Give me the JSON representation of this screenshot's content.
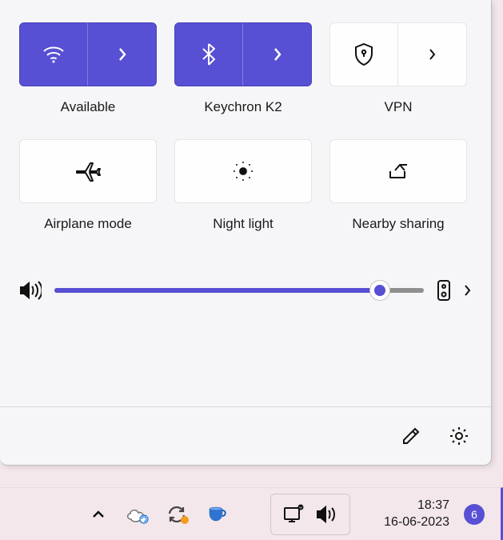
{
  "colors": {
    "accent": "#5750d4",
    "panel_bg": "#f6f6f8",
    "taskbar_bg": "#f4e7eb"
  },
  "quick_settings": {
    "tiles": [
      {
        "id": "wifi",
        "label": "Available",
        "active": true,
        "split": true,
        "icon": "wifi-icon"
      },
      {
        "id": "bluetooth",
        "label": "Keychron K2",
        "active": true,
        "split": true,
        "icon": "bluetooth-icon"
      },
      {
        "id": "vpn",
        "label": "VPN",
        "active": false,
        "split": true,
        "icon": "vpn-shield-icon"
      },
      {
        "id": "airplane",
        "label": "Airplane mode",
        "active": false,
        "split": false,
        "icon": "airplane-icon"
      },
      {
        "id": "nightlight",
        "label": "Night light",
        "active": false,
        "split": false,
        "icon": "night-light-icon"
      },
      {
        "id": "nearby",
        "label": "Nearby sharing",
        "active": false,
        "split": false,
        "icon": "nearby-sharing-icon"
      }
    ],
    "volume": {
      "percent": 88,
      "output_device": "speakers"
    }
  },
  "taskbar": {
    "tray_icons": [
      "chevron-up-icon",
      "onedrive-icon",
      "sync-icon",
      "coffee-icon"
    ],
    "system_tray": [
      "network-icon",
      "volume-icon"
    ],
    "time": "18:37",
    "date": "16-06-2023",
    "notification_count": "6"
  }
}
